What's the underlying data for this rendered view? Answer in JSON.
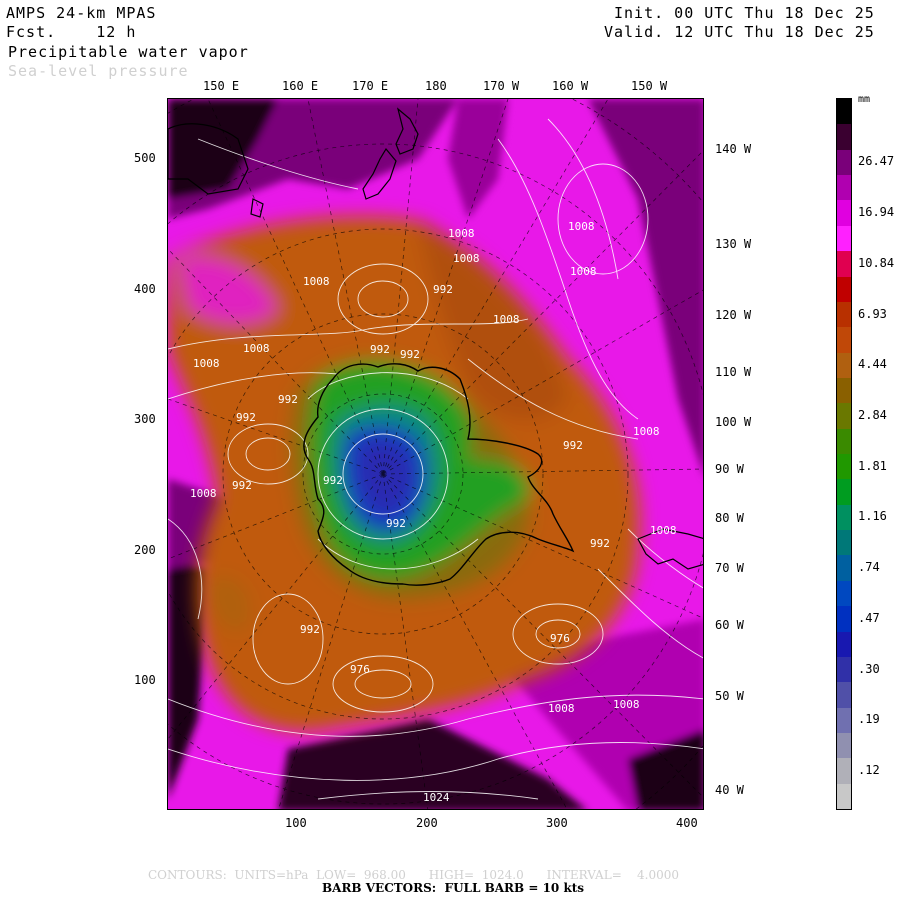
{
  "header": {
    "model": "AMPS 24-km MPAS",
    "forecast": "Fcst.    12 h",
    "field1": "Precipitable water vapor",
    "field2": "Sea-level pressure",
    "init": "Init. 00 UTC Thu 18 Dec 25",
    "valid": "Valid. 12 UTC Thu 18 Dec 25"
  },
  "top_longitudes": [
    "150 E",
    "160 E",
    "170 E",
    "180",
    "170 W",
    "160 W",
    "150 W"
  ],
  "right_longitudes": [
    "140 W",
    "130 W",
    "120 W",
    "110 W",
    "100 W",
    "90 W",
    "80 W",
    "70 W",
    "60 W",
    "50 W",
    "40 W"
  ],
  "y_ticks": [
    "500",
    "400",
    "300",
    "200",
    "100"
  ],
  "x_ticks": [
    "100",
    "200",
    "300",
    "400"
  ],
  "colorbar": {
    "unit": "mm",
    "labels": [
      "26.47",
      "16.94",
      "10.84",
      "6.93",
      "4.44",
      "2.84",
      "1.81",
      "1.16",
      ".74",
      ".47",
      ".30",
      ".19",
      ".12"
    ],
    "colors": [
      "#000000",
      "#3a0030",
      "#7a007a",
      "#b000b0",
      "#e000e0",
      "#ff20ff",
      "#e00050",
      "#c00000",
      "#b83000",
      "#c04808",
      "#b06010",
      "#8a6000",
      "#6a7800",
      "#3a8a00",
      "#209800",
      "#009c20",
      "#009060",
      "#007878",
      "#0060a0",
      "#0048c0",
      "#0030c0",
      "#1818b0",
      "#3030a8",
      "#5050a8",
      "#7070b0",
      "#9090b0",
      "#b0b0b8",
      "#c8c8c8"
    ]
  },
  "pressure_labels": [
    "1008",
    "1008",
    "1008",
    "1008",
    "1008",
    "1008",
    "1008",
    "1008",
    "1008",
    "1008",
    "1008",
    "1008",
    "1008",
    "1024",
    "992",
    "992",
    "992",
    "992",
    "992",
    "992",
    "992",
    "992",
    "992",
    "992",
    "992",
    "976",
    "976"
  ],
  "footer": {
    "contours": "CONTOURS:  UNITS=hPa  LOW=  968.00      HIGH=  1024.0      INTERVAL=    4.0000",
    "barbs": "BARB VECTORS:  FULL BARB = 10 kts"
  }
}
